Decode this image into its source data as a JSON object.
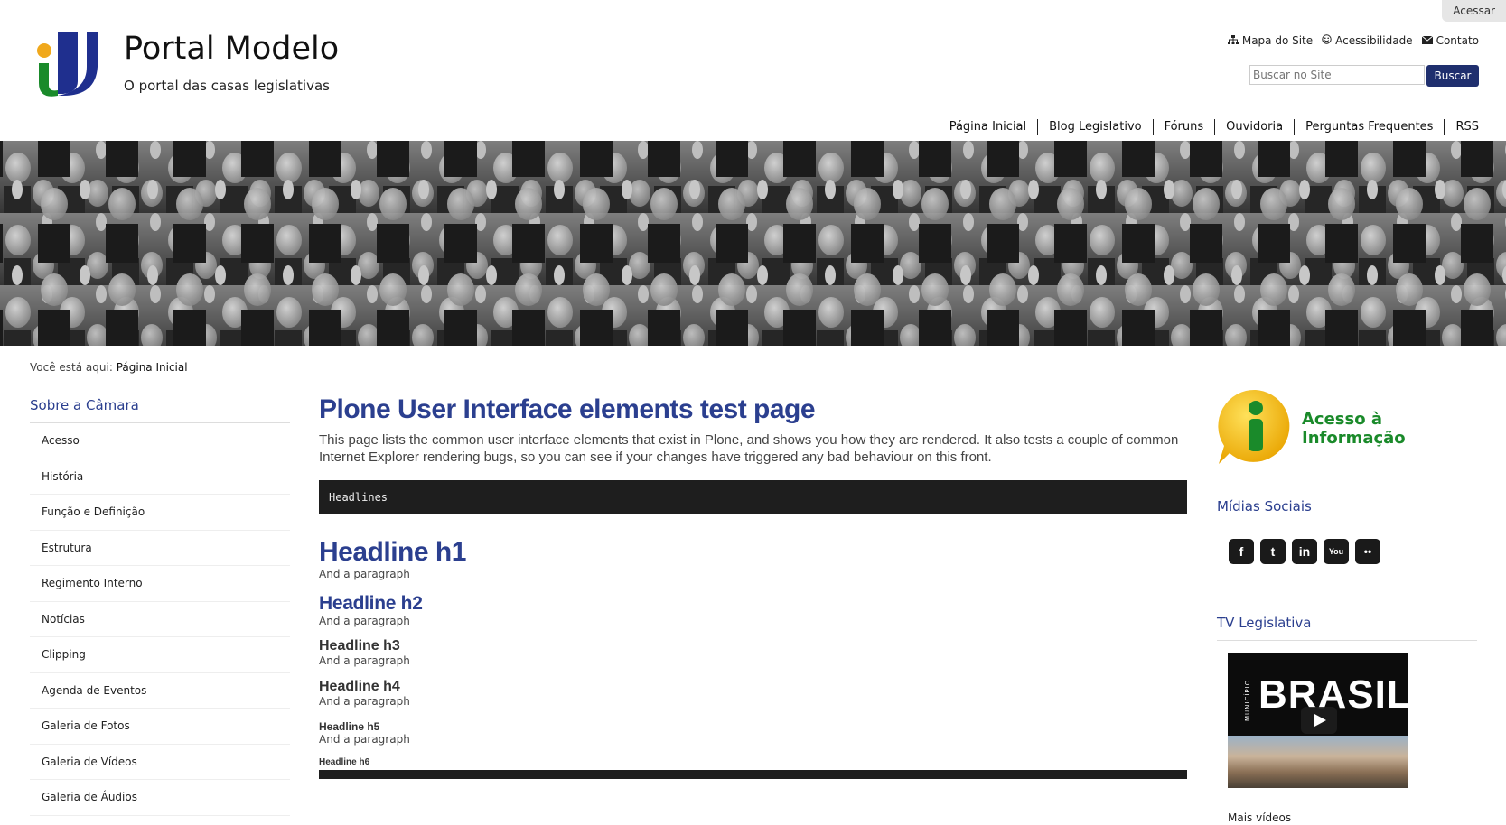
{
  "header": {
    "login": "Acessar",
    "site_title": "Portal Modelo",
    "site_description": "O portal das casas legislativas",
    "actions": [
      {
        "label": "Mapa do Site",
        "icon": "sitemap-icon"
      },
      {
        "label": "Acessibilidade",
        "icon": "accessibility-icon"
      },
      {
        "label": "Contato",
        "icon": "envelope-icon"
      }
    ],
    "search": {
      "placeholder": "Buscar no Site",
      "button": "Buscar"
    }
  },
  "globalnav": [
    "Página Inicial",
    "Blog Legislativo",
    "Fóruns",
    "Ouvidoria",
    "Perguntas Frequentes",
    "RSS"
  ],
  "breadcrumbs": {
    "prefix": "Você está aqui:",
    "current": "Página Inicial"
  },
  "left_portlet": {
    "title": "Sobre a Câmara",
    "items": [
      "Acesso",
      "História",
      "Função e Definição",
      "Estrutura",
      "Regimento Interno",
      "Notícias",
      "Clipping",
      "Agenda de Eventos",
      "Galeria de Fotos",
      "Galeria de Vídeos",
      "Galeria de Áudios"
    ]
  },
  "content": {
    "title": "Plone User Interface elements test page",
    "description": "This page lists the common user interface elements that exist in Plone, and shows you how they are rendered. It also tests a couple of common Internet Explorer rendering bugs, so you can see if your changes have triggered any bad behaviour on this front.",
    "code_label": "Headlines",
    "headlines": {
      "h1": "Headline h1",
      "h2": "Headline h2",
      "h3": "Headline h3",
      "h4": "Headline h4",
      "h5": "Headline h5",
      "h6": "Headline h6"
    },
    "paragraph": "And a paragraph"
  },
  "right_col": {
    "acesso_line1": "Acesso à",
    "acesso_line2": "Informação",
    "midias_title": "Mídias Sociais",
    "social": [
      {
        "icon": "facebook-icon",
        "glyph": "f"
      },
      {
        "icon": "twitter-icon",
        "glyph": "t"
      },
      {
        "icon": "linkedin-icon",
        "glyph": "in"
      },
      {
        "icon": "youtube-icon",
        "glyph": "You"
      },
      {
        "icon": "flickr-icon",
        "glyph": "••"
      }
    ],
    "tv_title": "TV Legislativa",
    "video_brand": "BRASIL",
    "video_sub": "MUNICÍPIO",
    "more_videos": "Mais vídeos"
  },
  "colors": {
    "brand_blue": "#2b3f8f",
    "button_navy": "#1f2f6e",
    "acesso_green": "#1a8a2a"
  }
}
